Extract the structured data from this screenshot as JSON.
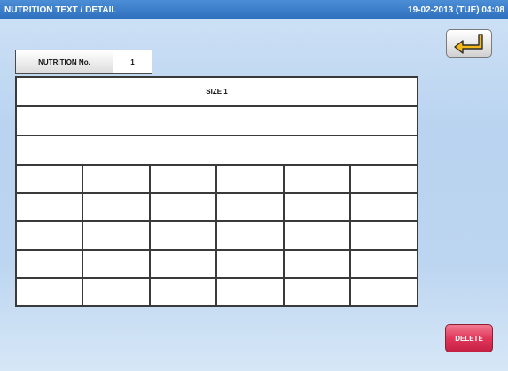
{
  "titlebar": {
    "title": "NUTRITION TEXT / DETAIL",
    "datetime": "19-02-2013 (TUE) 04:08"
  },
  "nutrition": {
    "label": "NUTRITION No.",
    "value": "1"
  },
  "table": {
    "header": "SIZE 1",
    "wide_rows": [
      "",
      ""
    ],
    "grid_rows": [
      [
        "",
        "",
        "",
        "",
        "",
        ""
      ],
      [
        "",
        "",
        "",
        "",
        "",
        ""
      ],
      [
        "",
        "",
        "",
        "",
        "",
        ""
      ],
      [
        "",
        "",
        "",
        "",
        "",
        ""
      ],
      [
        "",
        "",
        "",
        "",
        "",
        ""
      ]
    ]
  },
  "buttons": {
    "back_icon": "return-arrow-icon",
    "delete_label": "DELETE"
  },
  "colors": {
    "titlebar": "#2e6fbd",
    "delete": "#e0375a",
    "back_arrow": "#f0b400"
  }
}
